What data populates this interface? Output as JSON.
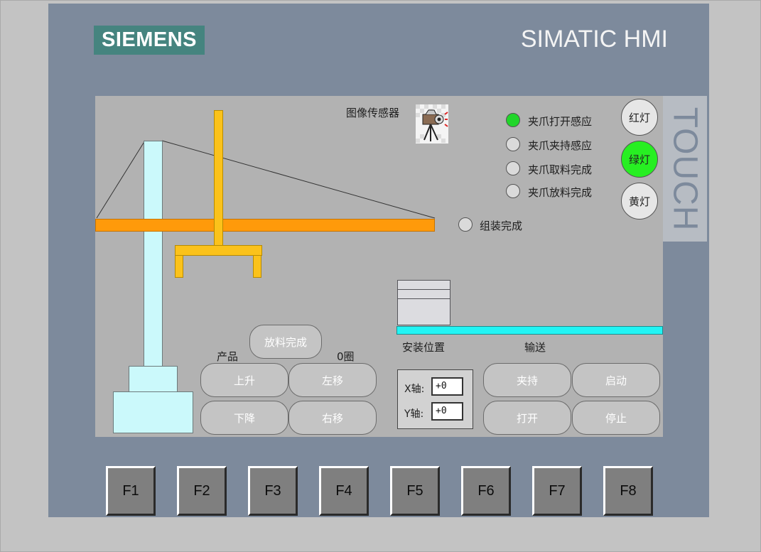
{
  "brand": {
    "logo": "SIEMENS",
    "title": "SIMATIC HMI",
    "touch": "TOUCH"
  },
  "sensor": {
    "label": "图像传感器"
  },
  "indicators": [
    {
      "label": "夹爪打开感应",
      "on": true
    },
    {
      "label": "夹爪夹持感应",
      "on": false
    },
    {
      "label": "夹爪取料完成",
      "on": false
    },
    {
      "label": "夹爪放料完成",
      "on": false
    }
  ],
  "assembly": {
    "label": "组装完成",
    "on": false
  },
  "lights": [
    {
      "label": "红灯",
      "on": false
    },
    {
      "label": "绿灯",
      "on": true
    },
    {
      "label": "黄灯",
      "on": false
    }
  ],
  "labels": {
    "product": "产品",
    "count": "0圈",
    "install_position": "安装位置",
    "conveyor": "输送"
  },
  "buttons": {
    "release_done": "放料完成",
    "up": "上升",
    "left": "左移",
    "down": "下降",
    "right": "右移",
    "clamp": "夹持",
    "start": "启动",
    "open": "打开",
    "stop": "停止"
  },
  "axes": {
    "x_label": "X轴:",
    "x_value": "+0",
    "y_label": "Y轴:",
    "y_value": "+0"
  },
  "fkeys": [
    "F1",
    "F2",
    "F3",
    "F4",
    "F5",
    "F6",
    "F7",
    "F8"
  ],
  "colors": {
    "bezel": "#7d8a9c",
    "screen": "#b2b2b2",
    "logo": "#45847f",
    "lamp_on": "#21d62a",
    "lamp_off": "#dadada",
    "beam": "#ff9a0a",
    "gripper": "#fbc21b",
    "tower": "#cbf9fb",
    "conveyor": "#22f4f4"
  }
}
